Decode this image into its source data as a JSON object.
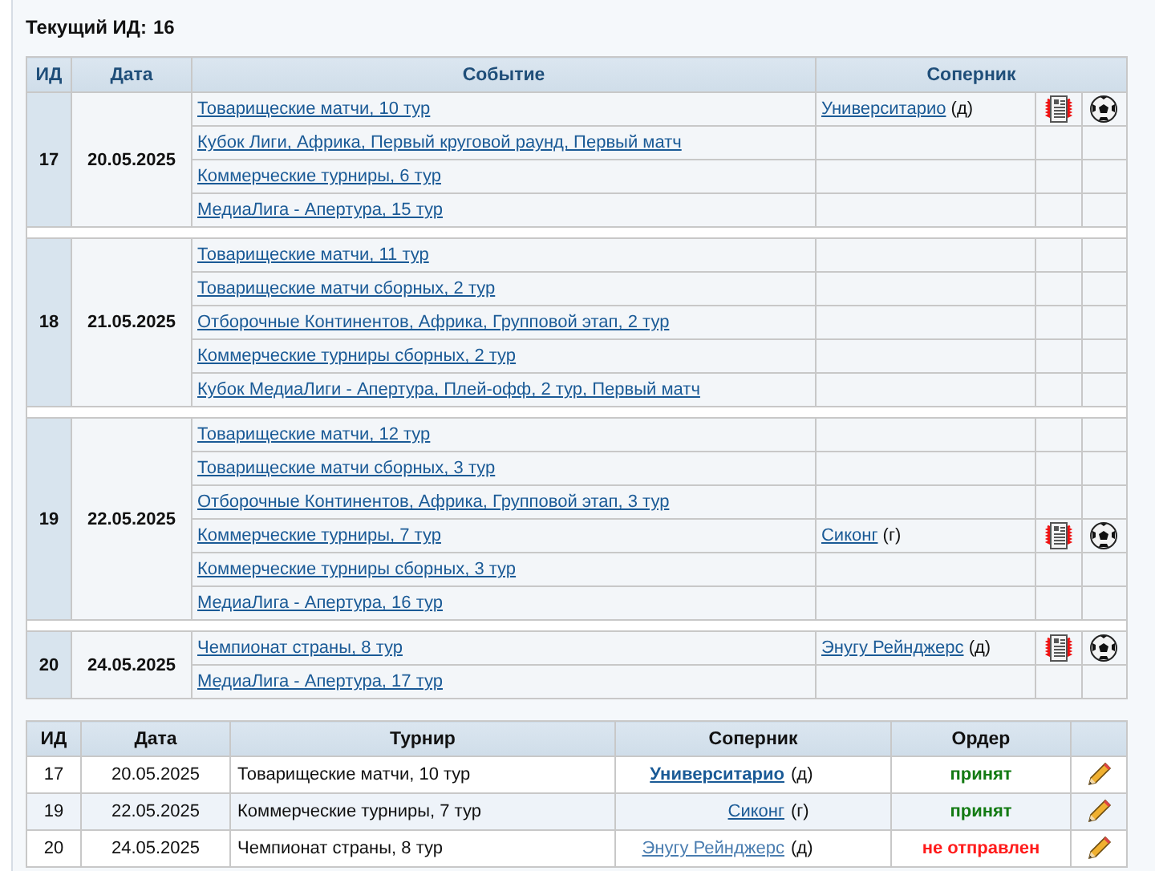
{
  "current_id": {
    "label": "Текущий ИД:",
    "value": "16"
  },
  "schedule": {
    "columns": [
      "ИД",
      "Дата",
      "Событие",
      "Соперник"
    ],
    "groups": [
      {
        "id": "17",
        "date": "20.05.2025",
        "events": [
          {
            "name": "Товарищеские матчи, 10 тур",
            "opponent": {
              "name": "Университарио",
              "venue": "(д)"
            }
          },
          {
            "name": "Кубок Лиги, Африка, Первый круговой раунд, Первый матч"
          },
          {
            "name": "Коммерческие турниры, 6 тур"
          },
          {
            "name": "МедиаЛига - Апертура, 15 тур"
          }
        ]
      },
      {
        "id": "18",
        "date": "21.05.2025",
        "events": [
          {
            "name": "Товарищеские матчи, 11 тур"
          },
          {
            "name": "Товарищеские матчи сборных, 2 тур"
          },
          {
            "name": "Отборочные Континентов, Африка, Групповой этап, 2 тур"
          },
          {
            "name": "Коммерческие турниры сборных, 2 тур"
          },
          {
            "name": "Кубок МедиаЛиги - Апертура, Плей-офф, 2 тур, Первый матч"
          }
        ]
      },
      {
        "id": "19",
        "date": "22.05.2025",
        "events": [
          {
            "name": "Товарищеские матчи, 12 тур"
          },
          {
            "name": "Товарищеские матчи сборных, 3 тур"
          },
          {
            "name": "Отборочные Континентов, Африка, Групповой этап, 3 тур"
          },
          {
            "name": "Коммерческие турниры, 7 тур",
            "opponent": {
              "name": "Сиконг",
              "venue": "(г)"
            }
          },
          {
            "name": "Коммерческие турниры сборных, 3 тур"
          },
          {
            "name": "МедиаЛига - Апертура, 16 тур"
          }
        ]
      },
      {
        "id": "20",
        "date": "24.05.2025",
        "events": [
          {
            "name": "Чемпионат страны, 8 тур",
            "opponent": {
              "name": "Энугу Рейнджерс",
              "venue": "(д)"
            }
          },
          {
            "name": "МедиаЛига - Апертура, 17 тур"
          }
        ]
      }
    ]
  },
  "orders": {
    "columns": [
      "ИД",
      "Дата",
      "Турнир",
      "Соперник",
      "Ордер"
    ],
    "rows": [
      {
        "id": "17",
        "date": "20.05.2025",
        "tournament": "Товарищеские матчи, 10 тур",
        "opponent": "Университарио",
        "venue": "(д)",
        "bold": true,
        "visited": false,
        "status": "принят",
        "kind": "accepted"
      },
      {
        "id": "19",
        "date": "22.05.2025",
        "tournament": "Коммерческие турниры, 7 тур",
        "opponent": "Сиконг",
        "venue": "(г)",
        "bold": false,
        "visited": false,
        "status": "принят",
        "kind": "accepted"
      },
      {
        "id": "20",
        "date": "24.05.2025",
        "tournament": "Чемпионат страны, 8 тур",
        "opponent": "Энугу Рейнджерс",
        "venue": "(д)",
        "bold": false,
        "visited": true,
        "status": "не отправлен",
        "kind": "not_sent"
      }
    ]
  }
}
